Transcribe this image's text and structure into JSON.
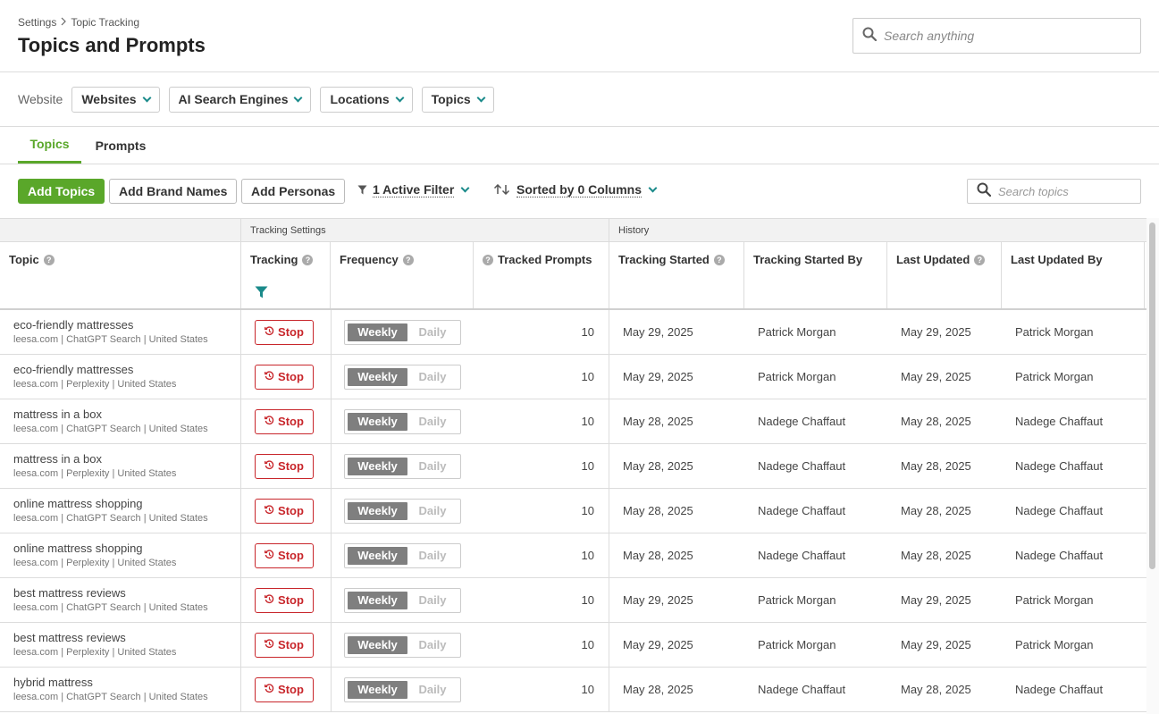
{
  "breadcrumb": {
    "items": [
      "Settings",
      "Topic Tracking"
    ]
  },
  "page_title": "Topics and Prompts",
  "global_search": {
    "placeholder": "Search anything"
  },
  "filters": {
    "label": "Website",
    "dropdowns": [
      "Websites",
      "AI Search Engines",
      "Locations",
      "Topics"
    ]
  },
  "tabs": [
    {
      "label": "Topics",
      "active": true
    },
    {
      "label": "Prompts",
      "active": false
    }
  ],
  "toolbar": {
    "add_topics": "Add Topics",
    "add_brand_names": "Add Brand Names",
    "add_personas": "Add Personas",
    "active_filter": "1 Active Filter",
    "sorted_by": "Sorted by 0 Columns",
    "search_placeholder": "Search topics"
  },
  "table": {
    "groups": {
      "tracking_settings": "Tracking Settings",
      "history": "History"
    },
    "columns": {
      "topic": "Topic",
      "tracking": "Tracking",
      "frequency": "Frequency",
      "tracked_prompts": "Tracked Prompts",
      "tracking_started": "Tracking Started",
      "tracking_started_by": "Tracking Started By",
      "last_updated": "Last Updated",
      "last_updated_by": "Last Updated By"
    },
    "stop_label": "Stop",
    "freq_on": "Weekly",
    "freq_off": "Daily",
    "rows": [
      {
        "topic": "eco-friendly mattresses",
        "sub": "leesa.com | ChatGPT Search | United States",
        "prompts": "10",
        "started": "May 29, 2025",
        "started_by": "Patrick Morgan",
        "updated": "May 29, 2025",
        "updated_by": "Patrick Morgan"
      },
      {
        "topic": "eco-friendly mattresses",
        "sub": "leesa.com | Perplexity | United States",
        "prompts": "10",
        "started": "May 29, 2025",
        "started_by": "Patrick Morgan",
        "updated": "May 29, 2025",
        "updated_by": "Patrick Morgan"
      },
      {
        "topic": "mattress in a box",
        "sub": "leesa.com | ChatGPT Search | United States",
        "prompts": "10",
        "started": "May 28, 2025",
        "started_by": "Nadege Chaffaut",
        "updated": "May 28, 2025",
        "updated_by": "Nadege Chaffaut"
      },
      {
        "topic": "mattress in a box",
        "sub": "leesa.com | Perplexity | United States",
        "prompts": "10",
        "started": "May 28, 2025",
        "started_by": "Nadege Chaffaut",
        "updated": "May 28, 2025",
        "updated_by": "Nadege Chaffaut"
      },
      {
        "topic": "online mattress shopping",
        "sub": "leesa.com | ChatGPT Search | United States",
        "prompts": "10",
        "started": "May 28, 2025",
        "started_by": "Nadege Chaffaut",
        "updated": "May 28, 2025",
        "updated_by": "Nadege Chaffaut"
      },
      {
        "topic": "online mattress shopping",
        "sub": "leesa.com | Perplexity | United States",
        "prompts": "10",
        "started": "May 28, 2025",
        "started_by": "Nadege Chaffaut",
        "updated": "May 28, 2025",
        "updated_by": "Nadege Chaffaut"
      },
      {
        "topic": "best mattress reviews",
        "sub": "leesa.com | ChatGPT Search | United States",
        "prompts": "10",
        "started": "May 29, 2025",
        "started_by": "Patrick Morgan",
        "updated": "May 29, 2025",
        "updated_by": "Patrick Morgan"
      },
      {
        "topic": "best mattress reviews",
        "sub": "leesa.com | Perplexity | United States",
        "prompts": "10",
        "started": "May 29, 2025",
        "started_by": "Patrick Morgan",
        "updated": "May 29, 2025",
        "updated_by": "Patrick Morgan"
      },
      {
        "topic": "hybrid mattress",
        "sub": "leesa.com | ChatGPT Search | United States",
        "prompts": "10",
        "started": "May 28, 2025",
        "started_by": "Nadege Chaffaut",
        "updated": "May 28, 2025",
        "updated_by": "Nadege Chaffaut"
      }
    ]
  },
  "colors": {
    "accent_green": "#5aa72a",
    "stop_red": "#c8262b",
    "teal_icon": "#1a8a8a"
  }
}
